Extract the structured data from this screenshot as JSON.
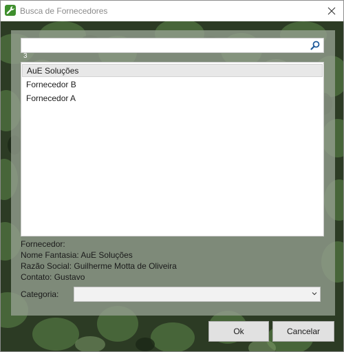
{
  "window": {
    "title": "Busca de Fornecedores",
    "app_icon": "wrench-icon",
    "close_icon": "close-icon"
  },
  "search": {
    "value": "",
    "placeholder": "",
    "icon": "search-icon"
  },
  "results_count": "3",
  "results": [
    {
      "label": "AuE Soluções",
      "selected": true
    },
    {
      "label": "Fornecedor B",
      "selected": false
    },
    {
      "label": "Fornecedor A",
      "selected": false
    }
  ],
  "details": {
    "header": "Fornecedor:",
    "nome_fantasia": "Nome Fantasia: AuE Soluções",
    "razao_social": "Razão Social: Guilherme Motta de Oliveira",
    "contato": "Contato: Gustavo"
  },
  "categoria": {
    "label": "Categoria:",
    "selected": "",
    "icon": "chevron-down-icon"
  },
  "buttons": {
    "ok": "Ok",
    "cancel": "Cancelar"
  },
  "colors": {
    "app_icon": "#3f8f2e",
    "overlay": "#96a091",
    "button_bg": "#e1e1e1",
    "selected_row": "#e8e8e8"
  }
}
